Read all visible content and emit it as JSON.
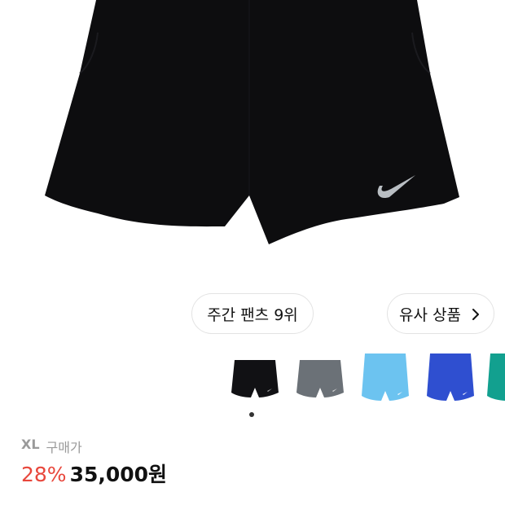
{
  "product": {
    "image_alt": "black running shorts",
    "colors": {
      "garment": "#0d0d0f",
      "logo": "#b9bec3"
    }
  },
  "chips": {
    "rank_label": "주간 팬츠 9위",
    "similar_label": "유사 상품"
  },
  "thumbnails": [
    {
      "name": "black",
      "color": "#111114"
    },
    {
      "name": "gray",
      "color": "#6b7177"
    },
    {
      "name": "sky-blue",
      "color": "#6cc3f0"
    },
    {
      "name": "royal-blue",
      "color": "#2f4fd0"
    },
    {
      "name": "teal",
      "color": "#12a08f"
    }
  ],
  "carousel": {
    "active_index": 0
  },
  "purchase": {
    "size": "XL",
    "size_suffix": "구매가",
    "discount": "28%",
    "price": "35,000원"
  }
}
